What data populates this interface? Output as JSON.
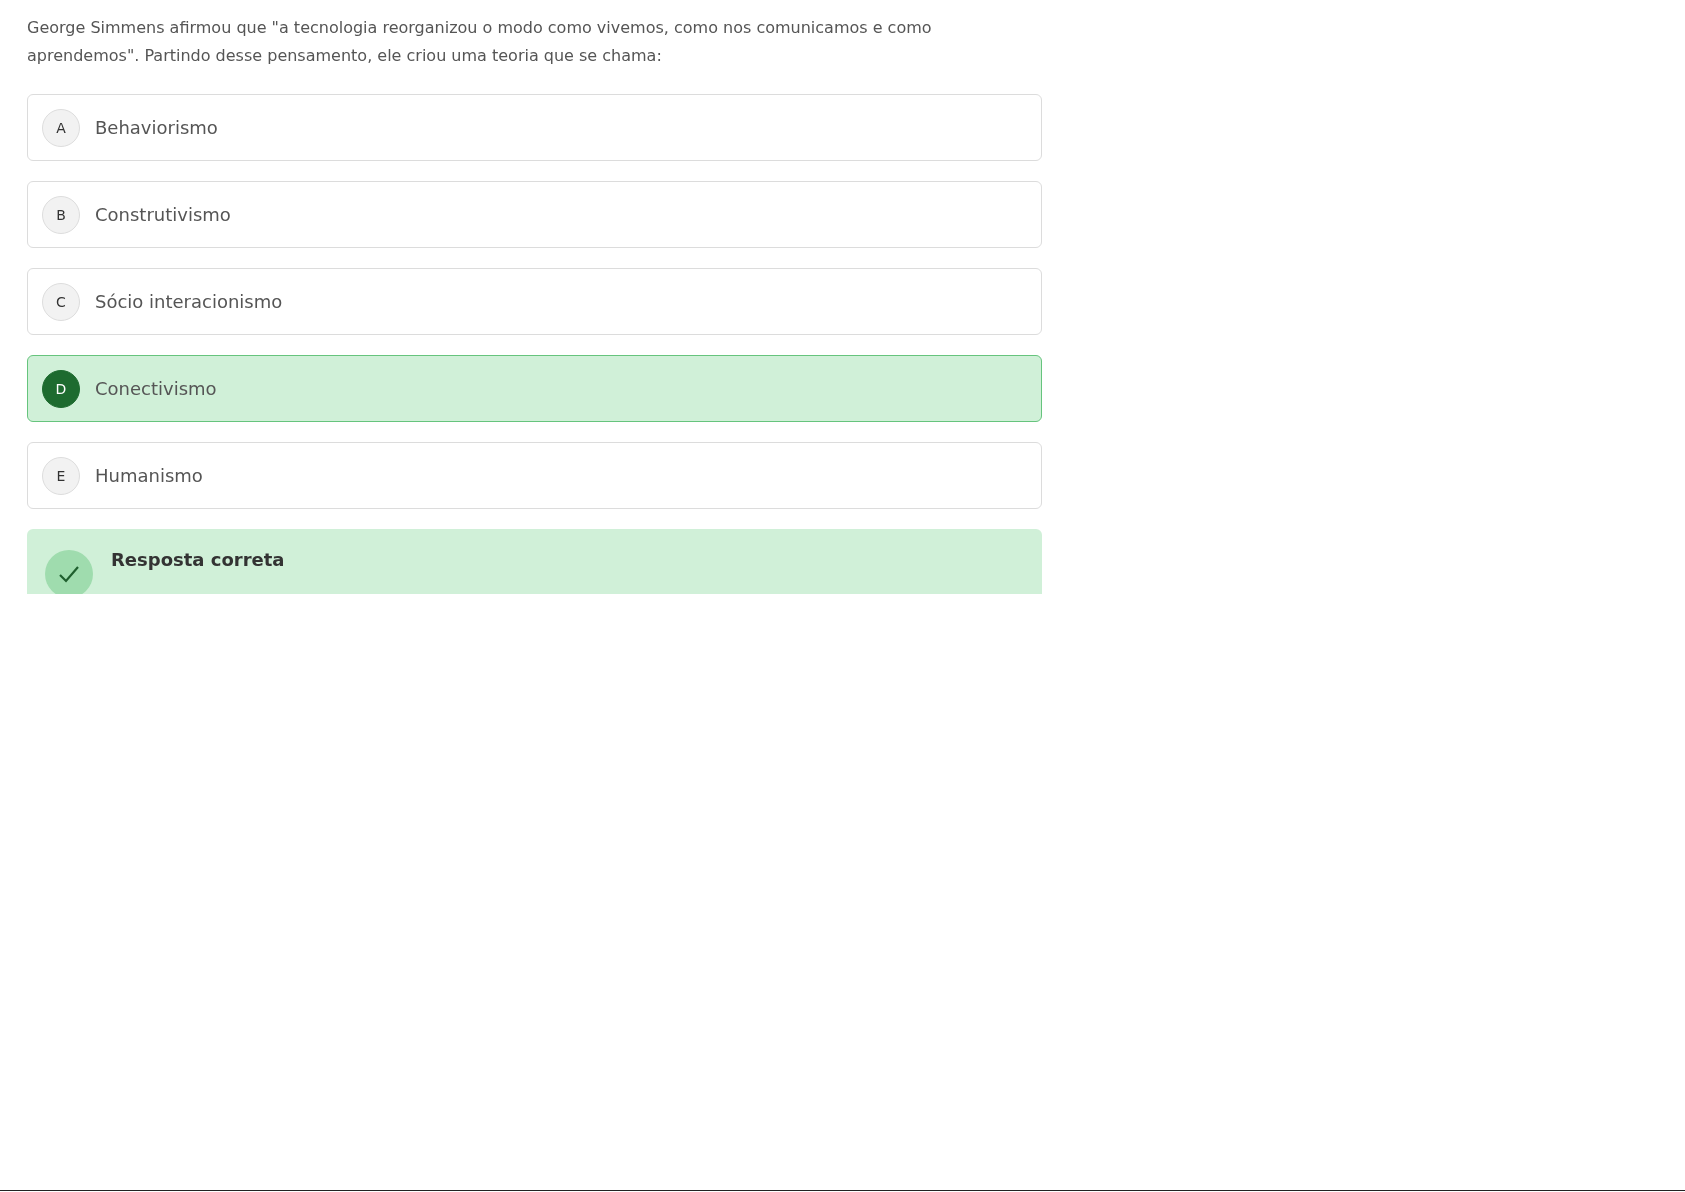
{
  "question": "George Simmens afirmou que \"a tecnologia reorganizou o modo como vivemos, como nos comunicamos e como aprendemos\". Partindo desse pensamento, ele criou uma teoria que se chama:",
  "options": [
    {
      "letter": "A",
      "text": "Behaviorismo",
      "selected": false
    },
    {
      "letter": "B",
      "text": "Construtivismo",
      "selected": false
    },
    {
      "letter": "C",
      "text": "Sócio interacionismo",
      "selected": false
    },
    {
      "letter": "D",
      "text": "Conectivismo",
      "selected": true
    },
    {
      "letter": "E",
      "text": "Humanismo",
      "selected": false
    }
  ],
  "feedback": {
    "kind": "correct",
    "title": "Resposta correta"
  }
}
